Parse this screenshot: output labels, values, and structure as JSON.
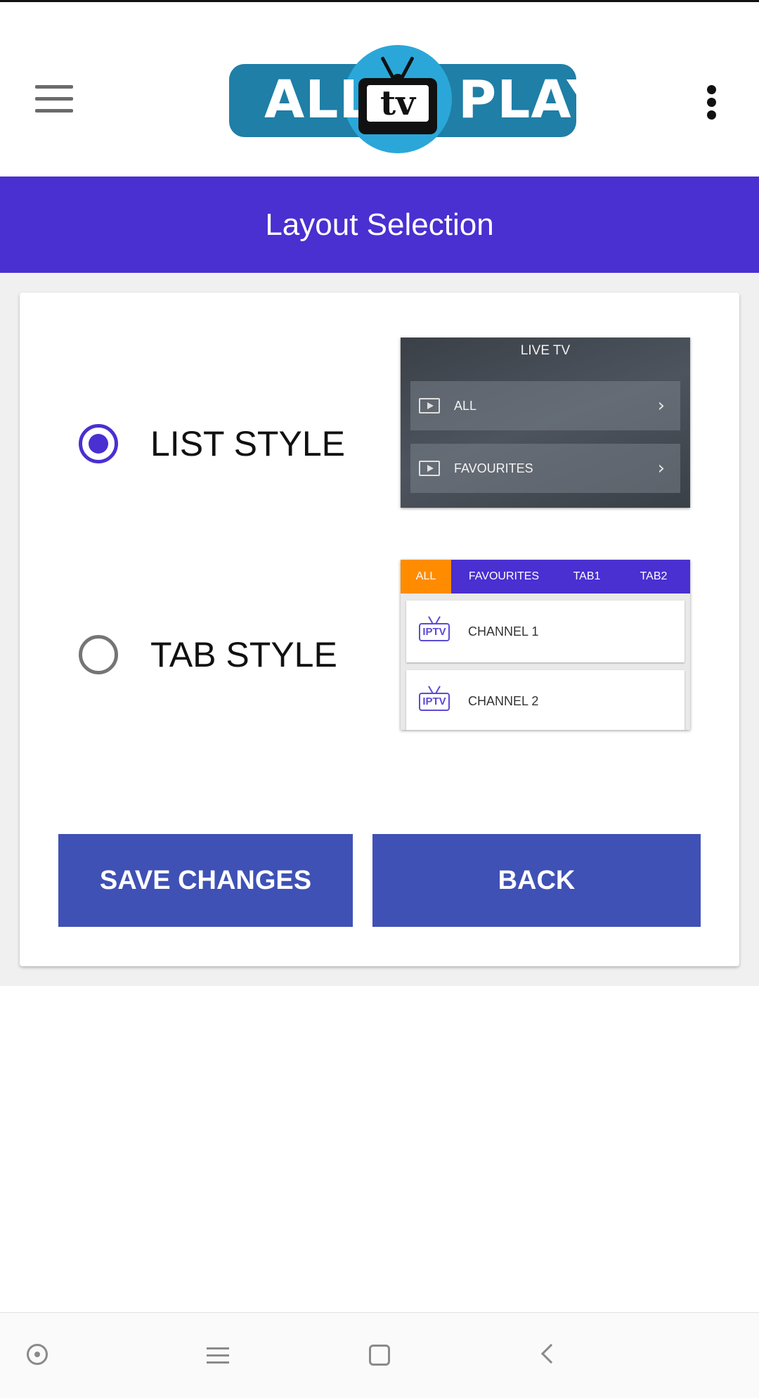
{
  "app": {
    "logo_left": "ALL",
    "logo_center": "tv",
    "logo_right": "PLAY"
  },
  "page": {
    "title": "Layout Selection"
  },
  "options": [
    {
      "label": "LIST STYLE",
      "selected": true
    },
    {
      "label": "TAB STYLE",
      "selected": false
    }
  ],
  "list_preview": {
    "title": "LIVE TV",
    "rows": [
      "ALL",
      "FAVOURITES"
    ]
  },
  "tab_preview": {
    "tabs": [
      "ALL",
      "FAVOURITES",
      "TAB1",
      "TAB2"
    ],
    "logo_text": "IPTV",
    "channels": [
      "CHANNEL 1",
      "CHANNEL 2"
    ]
  },
  "buttons": {
    "save": "SAVE CHANGES",
    "back": "BACK"
  },
  "colors": {
    "primary": "#4a2fd1",
    "button": "#3f51b5",
    "active_tab": "#ff8c00",
    "logo_blue": "#1f7fa6"
  },
  "icons": {
    "menu": "hamburger-icon",
    "overflow": "more-vert-icon",
    "nav": [
      "circle-dot-icon",
      "menu-lines-icon",
      "square-home-icon",
      "chevron-back-icon"
    ]
  }
}
